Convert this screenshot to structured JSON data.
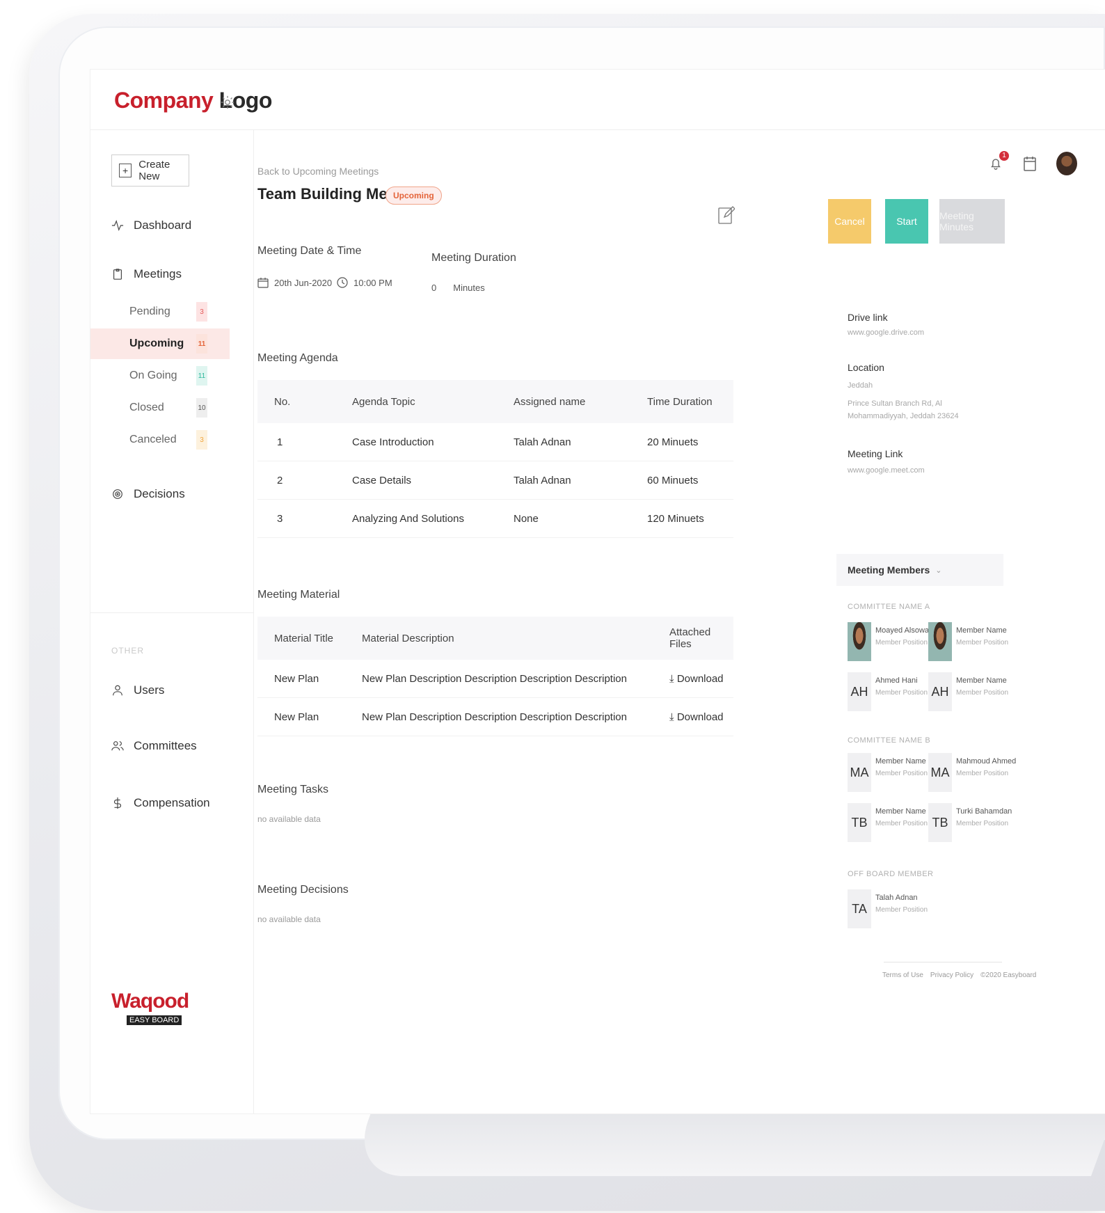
{
  "brand": {
    "logo_part1": "Company",
    "logo_part2": "Logo",
    "footer_name": "Waqood",
    "footer_tag": "EASY BOARD"
  },
  "header": {
    "notification_count": "1"
  },
  "sidebar": {
    "create_label": "Create New",
    "dashboard": "Dashboard",
    "meetings": "Meetings",
    "sub": [
      {
        "label": "Pending",
        "count": "3",
        "color": "#e35b5b",
        "bg": "#fde3e3"
      },
      {
        "label": "Upcoming",
        "count": "11",
        "color": "#e4643a",
        "bg": "#fce3dc"
      },
      {
        "label": "On Going",
        "count": "11",
        "color": "#2fb79c",
        "bg": "#dff5f0"
      },
      {
        "label": "Closed",
        "count": "10",
        "color": "#555555",
        "bg": "#eeeeee"
      },
      {
        "label": "Canceled",
        "count": "3",
        "color": "#f0a640",
        "bg": "#fdf1dd"
      }
    ],
    "decisions": "Decisions",
    "other_label": "OTHER",
    "users": "Users",
    "committees": "Committees",
    "compensation": "Compensation"
  },
  "main": {
    "back_link": "Back to Upcoming Meetings",
    "title": "Team Building Meetings",
    "status": "Upcoming",
    "date_time_label": "Meeting Date & Time",
    "date": "20th Jun-2020",
    "time": "10:00 PM",
    "duration_label": "Meeting Duration",
    "duration_value": "0",
    "duration_unit": "Minutes",
    "agenda_label": "Meeting Agenda",
    "agenda_headers": [
      "No.",
      "Agenda Topic",
      "Assigned name",
      "Time Duration"
    ],
    "agenda_rows": [
      [
        "1",
        "Case Introduction",
        "Talah Adnan",
        "20 Minuets"
      ],
      [
        "2",
        "Case Details",
        "Talah Adnan",
        "60 Minuets"
      ],
      [
        "3",
        "Analyzing And Solutions",
        "None",
        "120 Minuets"
      ]
    ],
    "material_label": "Meeting Material",
    "material_headers": [
      "Material Title",
      "Material Description",
      "Attached Files"
    ],
    "material_rows": [
      [
        "New Plan",
        "New Plan Description Description Description Description",
        "Download"
      ],
      [
        "New Plan",
        "New Plan Description Description Description Description",
        "Download"
      ]
    ],
    "tasks_label": "Meeting Tasks",
    "tasks_empty": "no available data",
    "decisions_label": "Meeting Decisions",
    "decisions_empty": "no available data"
  },
  "right": {
    "cancel": "Cancel",
    "start": "Start",
    "minutes": "Meeting Minutes",
    "drive_label": "Drive link",
    "drive_value": "www.google.drive.com",
    "location_label": "Location",
    "location_city": "Jeddah",
    "location_line1": "Prince Sultan Branch Rd, Al",
    "location_line2": "Mohammadiyyah, Jeddah 23624",
    "link_label": "Meeting Link",
    "link_value": "www.google.meet.com",
    "members_label": "Meeting Members",
    "group_a": "COMMITTEE NAME A",
    "group_b": "COMMITTEE NAME B",
    "group_off": "OFF BOARD MEMBER",
    "members_a": [
      {
        "initials": "",
        "name": "Moayed Alsowagh",
        "position": "Member Position"
      },
      {
        "initials": "",
        "name": "Member Name",
        "position": "Member Position"
      },
      {
        "initials": "AH",
        "name": "Ahmed Hani",
        "position": "Member Position"
      },
      {
        "initials": "AH",
        "name": "Member Name",
        "position": "Member Position"
      }
    ],
    "members_b": [
      {
        "initials": "MA",
        "name": "Member Name",
        "position": "Member Position"
      },
      {
        "initials": "MA",
        "name": "Mahmoud Ahmed",
        "position": "Member Position"
      },
      {
        "initials": "TB",
        "name": "Member Name",
        "position": "Member Position"
      },
      {
        "initials": "TB",
        "name": "Turki Bahamdan",
        "position": "Member Position"
      }
    ],
    "members_off": [
      {
        "initials": "TA",
        "name": "Talah Adnan",
        "position": "Member Position"
      }
    ],
    "footer": [
      "Terms of Use",
      "Privacy Policy",
      "©2020 Easyboard"
    ]
  }
}
